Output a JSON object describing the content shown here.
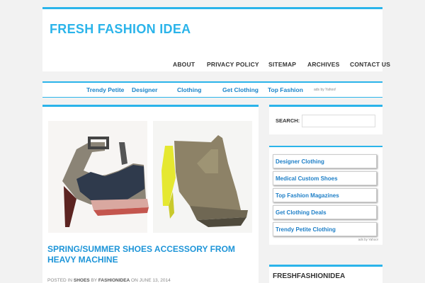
{
  "header": {
    "site_title": "FRESH FASHION IDEA",
    "nav": [
      "ABOUT",
      "PRIVACY POLICY",
      "SITEMAP",
      "ARCHIVES",
      "CONTACT US"
    ]
  },
  "adbar": {
    "links": [
      "Trendy Petite",
      "Designer",
      "Clothing",
      "Get Clothing",
      "Top Fashion"
    ],
    "ads_label": "ads by Yahoo!"
  },
  "post": {
    "title": "SPRING/SUMMER SHOES ACCESSORY FROM HEAVY MACHINE",
    "meta": {
      "posted_in": "POSTED IN",
      "category": "SHOES",
      "by": "BY",
      "author": "FASHIONIDEA",
      "on": "ON",
      "date": "JUNE 13, 2014"
    }
  },
  "sidebar": {
    "search_label": "SEARCH:",
    "links": [
      "Designer Clothing",
      "Medical Custom Shoes",
      "Top Fashion Magazines",
      "Get Clothing Deals",
      "Trendy Petite Clothing"
    ],
    "ads_label": "ads by Yahoo!",
    "widget_title": "FRESHFASHIONIDEA"
  },
  "colors": {
    "accent": "#2bb4ea",
    "link": "#1e7fc7",
    "background": "#f2f2f2"
  }
}
